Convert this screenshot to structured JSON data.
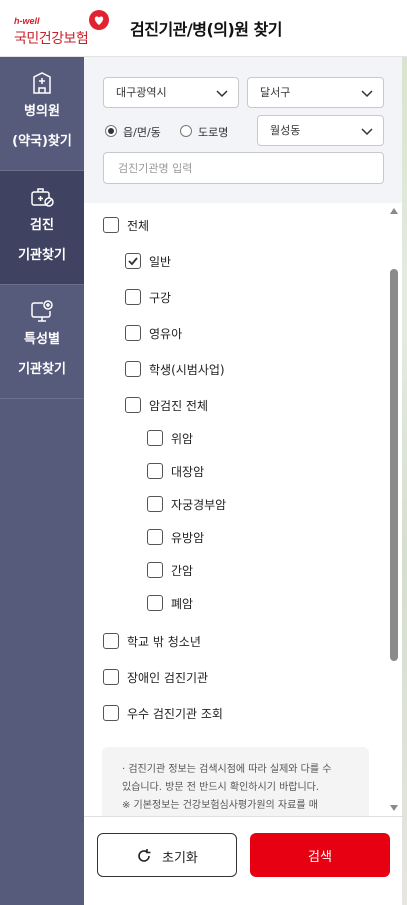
{
  "header": {
    "logo_tagline": "h-well",
    "logo_name": "국민건강보험",
    "title": "검진기관/병(의)원 찾기"
  },
  "sidebar": {
    "items": [
      {
        "line1": "병의원",
        "line2": "(약국)찾기",
        "icon": "hospital-icon",
        "active": false
      },
      {
        "line1": "검진",
        "line2": "기관찾기",
        "icon": "medical-bag-icon",
        "active": true
      },
      {
        "line1": "특성별",
        "line2": "기관찾기",
        "icon": "screen-plus-icon",
        "active": false
      }
    ]
  },
  "filters": {
    "city": "대구광역시",
    "district": "달서구",
    "radio_options": [
      {
        "label": "읍/면/동",
        "selected": true
      },
      {
        "label": "도로명",
        "selected": false
      }
    ],
    "dong": "월성동",
    "search_placeholder": "검진기관명 입력",
    "search_value": ""
  },
  "checklist": [
    {
      "label": "전체",
      "checked": false,
      "level": 0
    },
    {
      "label": "일반",
      "checked": true,
      "level": 1
    },
    {
      "label": "구강",
      "checked": false,
      "level": 1
    },
    {
      "label": "영유아",
      "checked": false,
      "level": 1
    },
    {
      "label": "학생(시범사업)",
      "checked": false,
      "level": 1
    },
    {
      "label": "암검진 전체",
      "checked": false,
      "level": 1
    },
    {
      "label": "위암",
      "checked": false,
      "level": 2
    },
    {
      "label": "대장암",
      "checked": false,
      "level": 2
    },
    {
      "label": "자궁경부암",
      "checked": false,
      "level": 2
    },
    {
      "label": "유방암",
      "checked": false,
      "level": 2
    },
    {
      "label": "간암",
      "checked": false,
      "level": 2
    },
    {
      "label": "폐암",
      "checked": false,
      "level": 2
    },
    {
      "label": "학교 밖 청소년",
      "checked": false,
      "level": 0
    },
    {
      "label": "장애인 검진기관",
      "checked": false,
      "level": 0
    },
    {
      "label": "우수 검진기관 조회",
      "checked": false,
      "level": 0
    }
  ],
  "notice": {
    "line1": "· 검진기관 정보는 검색시점에 따라 실제와 다를 수",
    "line2": "있습니다. 방문 전 반드시 확인하시기 바랍니다.",
    "line3": "※ 기본정보는 건강보험심사평가원의 자료를 매"
  },
  "footer": {
    "reset_label": "초기화",
    "search_label": "검색"
  },
  "colors": {
    "sidebar": "#565b7b",
    "sidebar_active": "#3f4361",
    "brand_red": "#e60012",
    "filter_bg": "#f3f4f8"
  }
}
